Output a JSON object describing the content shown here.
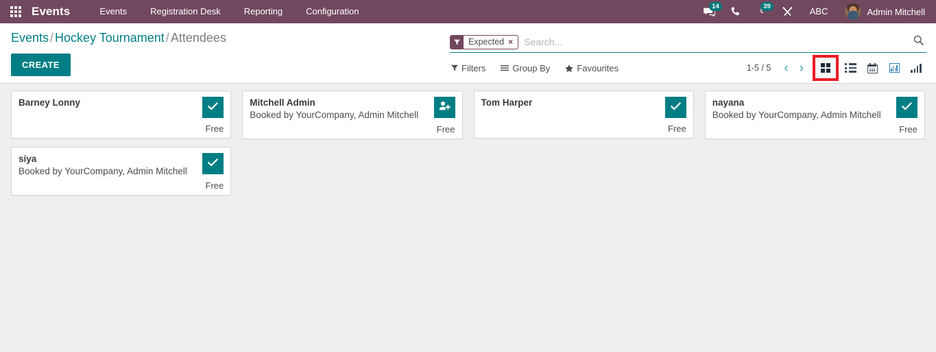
{
  "navbar": {
    "apps_icon": "apps-grid-icon",
    "brand": "Events",
    "menus": [
      {
        "label": "Events"
      },
      {
        "label": "Registration Desk"
      },
      {
        "label": "Reporting"
      },
      {
        "label": "Configuration"
      }
    ],
    "systray": {
      "messages_badge": "14",
      "activities_badge": "39",
      "debug_label": "ABC",
      "user_name": "Admin Mitchell"
    }
  },
  "control_panel": {
    "breadcrumb": {
      "root": "Events",
      "sep1": "/",
      "parent": "Hockey Tournament",
      "sep2": "/",
      "current": "Attendees"
    },
    "create_label": "CREATE",
    "search": {
      "facet_label": "Expected",
      "facet_remove": "×",
      "placeholder": "Search..."
    },
    "buttons": {
      "filters": "Filters",
      "group_by": "Group By",
      "favourites": "Favourites"
    },
    "pager": {
      "count": "1-5 / 5",
      "prev": "‹",
      "next": "›"
    },
    "views": [
      {
        "name": "kanban",
        "active": true
      },
      {
        "name": "list",
        "active": false
      },
      {
        "name": "calendar",
        "active": false
      },
      {
        "name": "graph",
        "active": false
      },
      {
        "name": "pivot",
        "active": false
      }
    ]
  },
  "kanban": {
    "cards": [
      {
        "name": "Barney Lonny",
        "subtitle": "",
        "badge": "check",
        "footer": "Free"
      },
      {
        "name": "Mitchell Admin",
        "subtitle": "Booked by YourCompany, Admin Mitchell",
        "badge": "user-plus",
        "footer": "Free"
      },
      {
        "name": "Tom Harper",
        "subtitle": "",
        "badge": "check",
        "footer": "Free"
      },
      {
        "name": "nayana",
        "subtitle": "Booked by YourCompany, Admin Mitchell",
        "badge": "check",
        "footer": "Free"
      },
      {
        "name": "siya",
        "subtitle": "Booked by YourCompany, Admin Mitchell",
        "badge": "check",
        "footer": "Free"
      }
    ]
  },
  "colors": {
    "navbar_purple": "#71485e",
    "accent_teal": "#017e84",
    "annotation_red": "#ec1c24",
    "page_background": "#f0eeee"
  }
}
